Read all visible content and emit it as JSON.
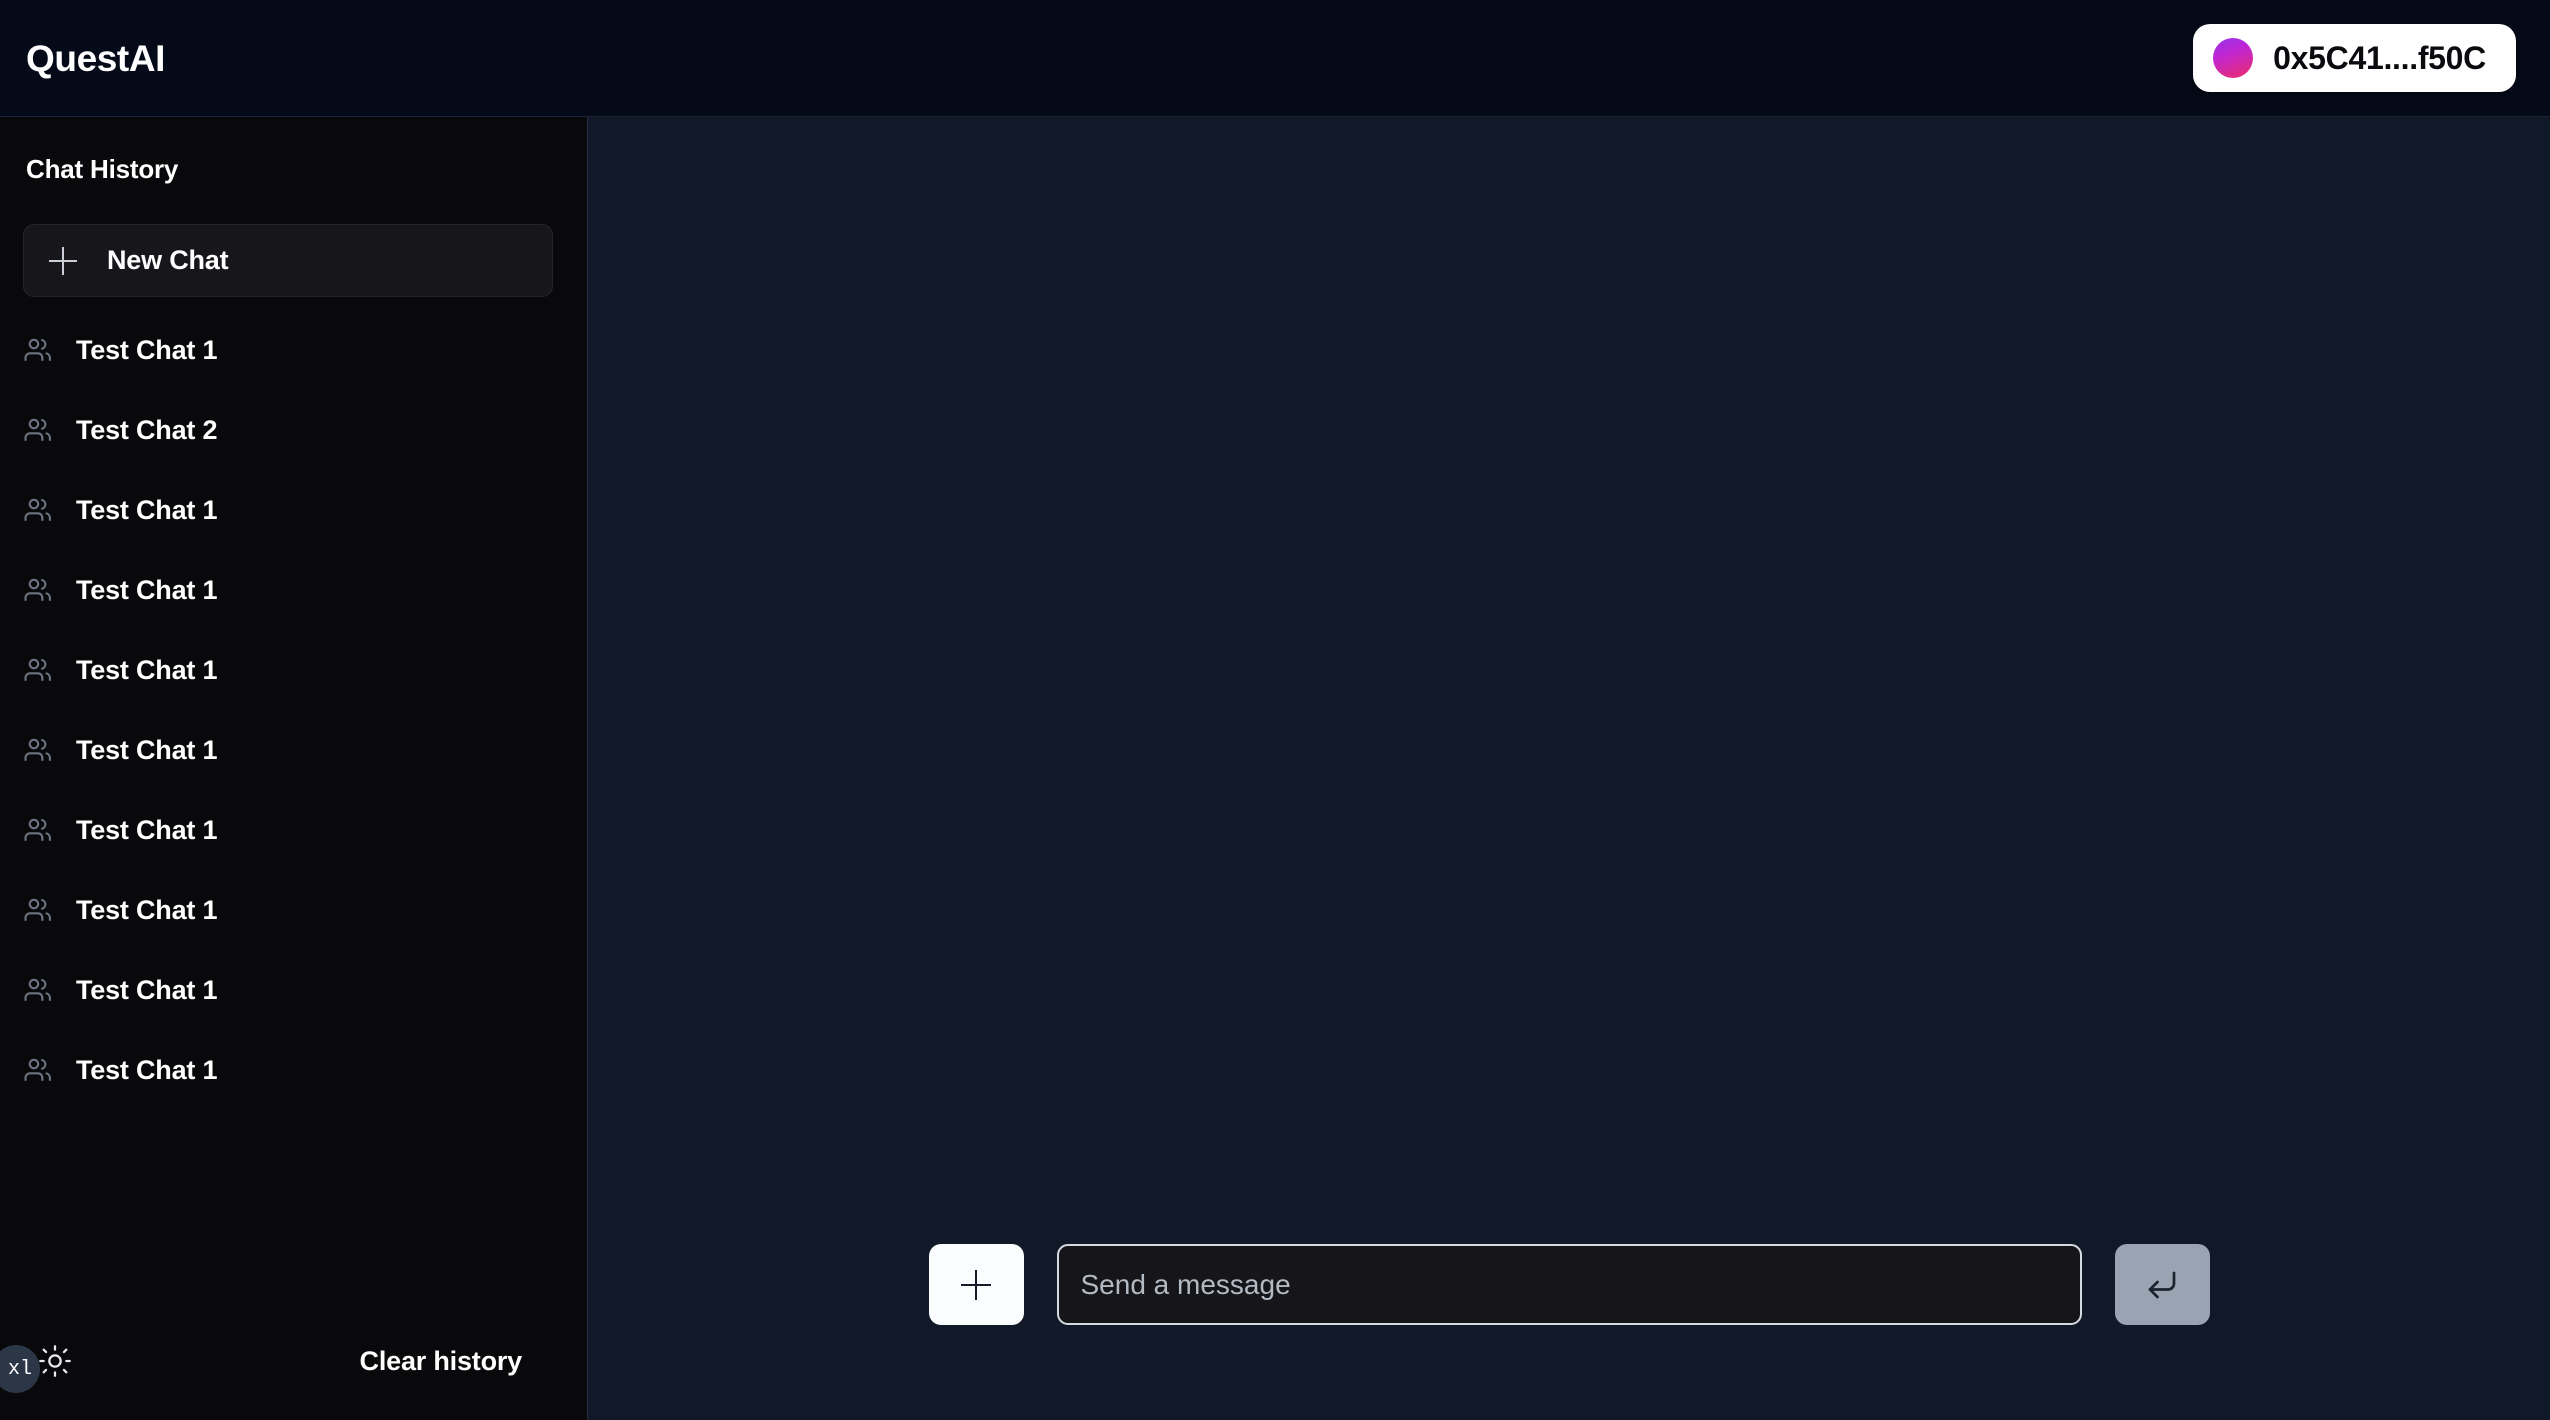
{
  "header": {
    "brand": "QuestAI",
    "wallet": {
      "address": "0x5C41....f50C",
      "avatar_icon": "wallet-avatar-gradient-circle",
      "gradient_from": "#9333ea",
      "gradient_to": "#ec2c6a"
    },
    "background_color": "#050a18"
  },
  "sidebar": {
    "title": "Chat History",
    "background_color": "#09090b",
    "new_chat": {
      "label": "New Chat",
      "icon": "plus-icon"
    },
    "chats": [
      {
        "label": "Test Chat 1",
        "icon": "users-icon"
      },
      {
        "label": "Test Chat 2",
        "icon": "users-icon"
      },
      {
        "label": "Test Chat 1",
        "icon": "users-icon"
      },
      {
        "label": "Test Chat 1",
        "icon": "users-icon"
      },
      {
        "label": "Test Chat 1",
        "icon": "users-icon"
      },
      {
        "label": "Test Chat 1",
        "icon": "users-icon"
      },
      {
        "label": "Test Chat 1",
        "icon": "users-icon"
      },
      {
        "label": "Test Chat 1",
        "icon": "users-icon"
      },
      {
        "label": "Test Chat 1",
        "icon": "users-icon"
      },
      {
        "label": "Test Chat 1",
        "icon": "users-icon"
      }
    ],
    "footer": {
      "theme_toggle_icon": "sun-icon",
      "clear_history_label": "Clear history"
    }
  },
  "breakpoint_badge": {
    "label": "xl"
  },
  "main": {
    "background_color": "#111827",
    "composer": {
      "attach_icon": "plus-icon",
      "input_placeholder": "Send a message",
      "input_value": "",
      "send_icon": "enter-arrow-icon"
    }
  }
}
